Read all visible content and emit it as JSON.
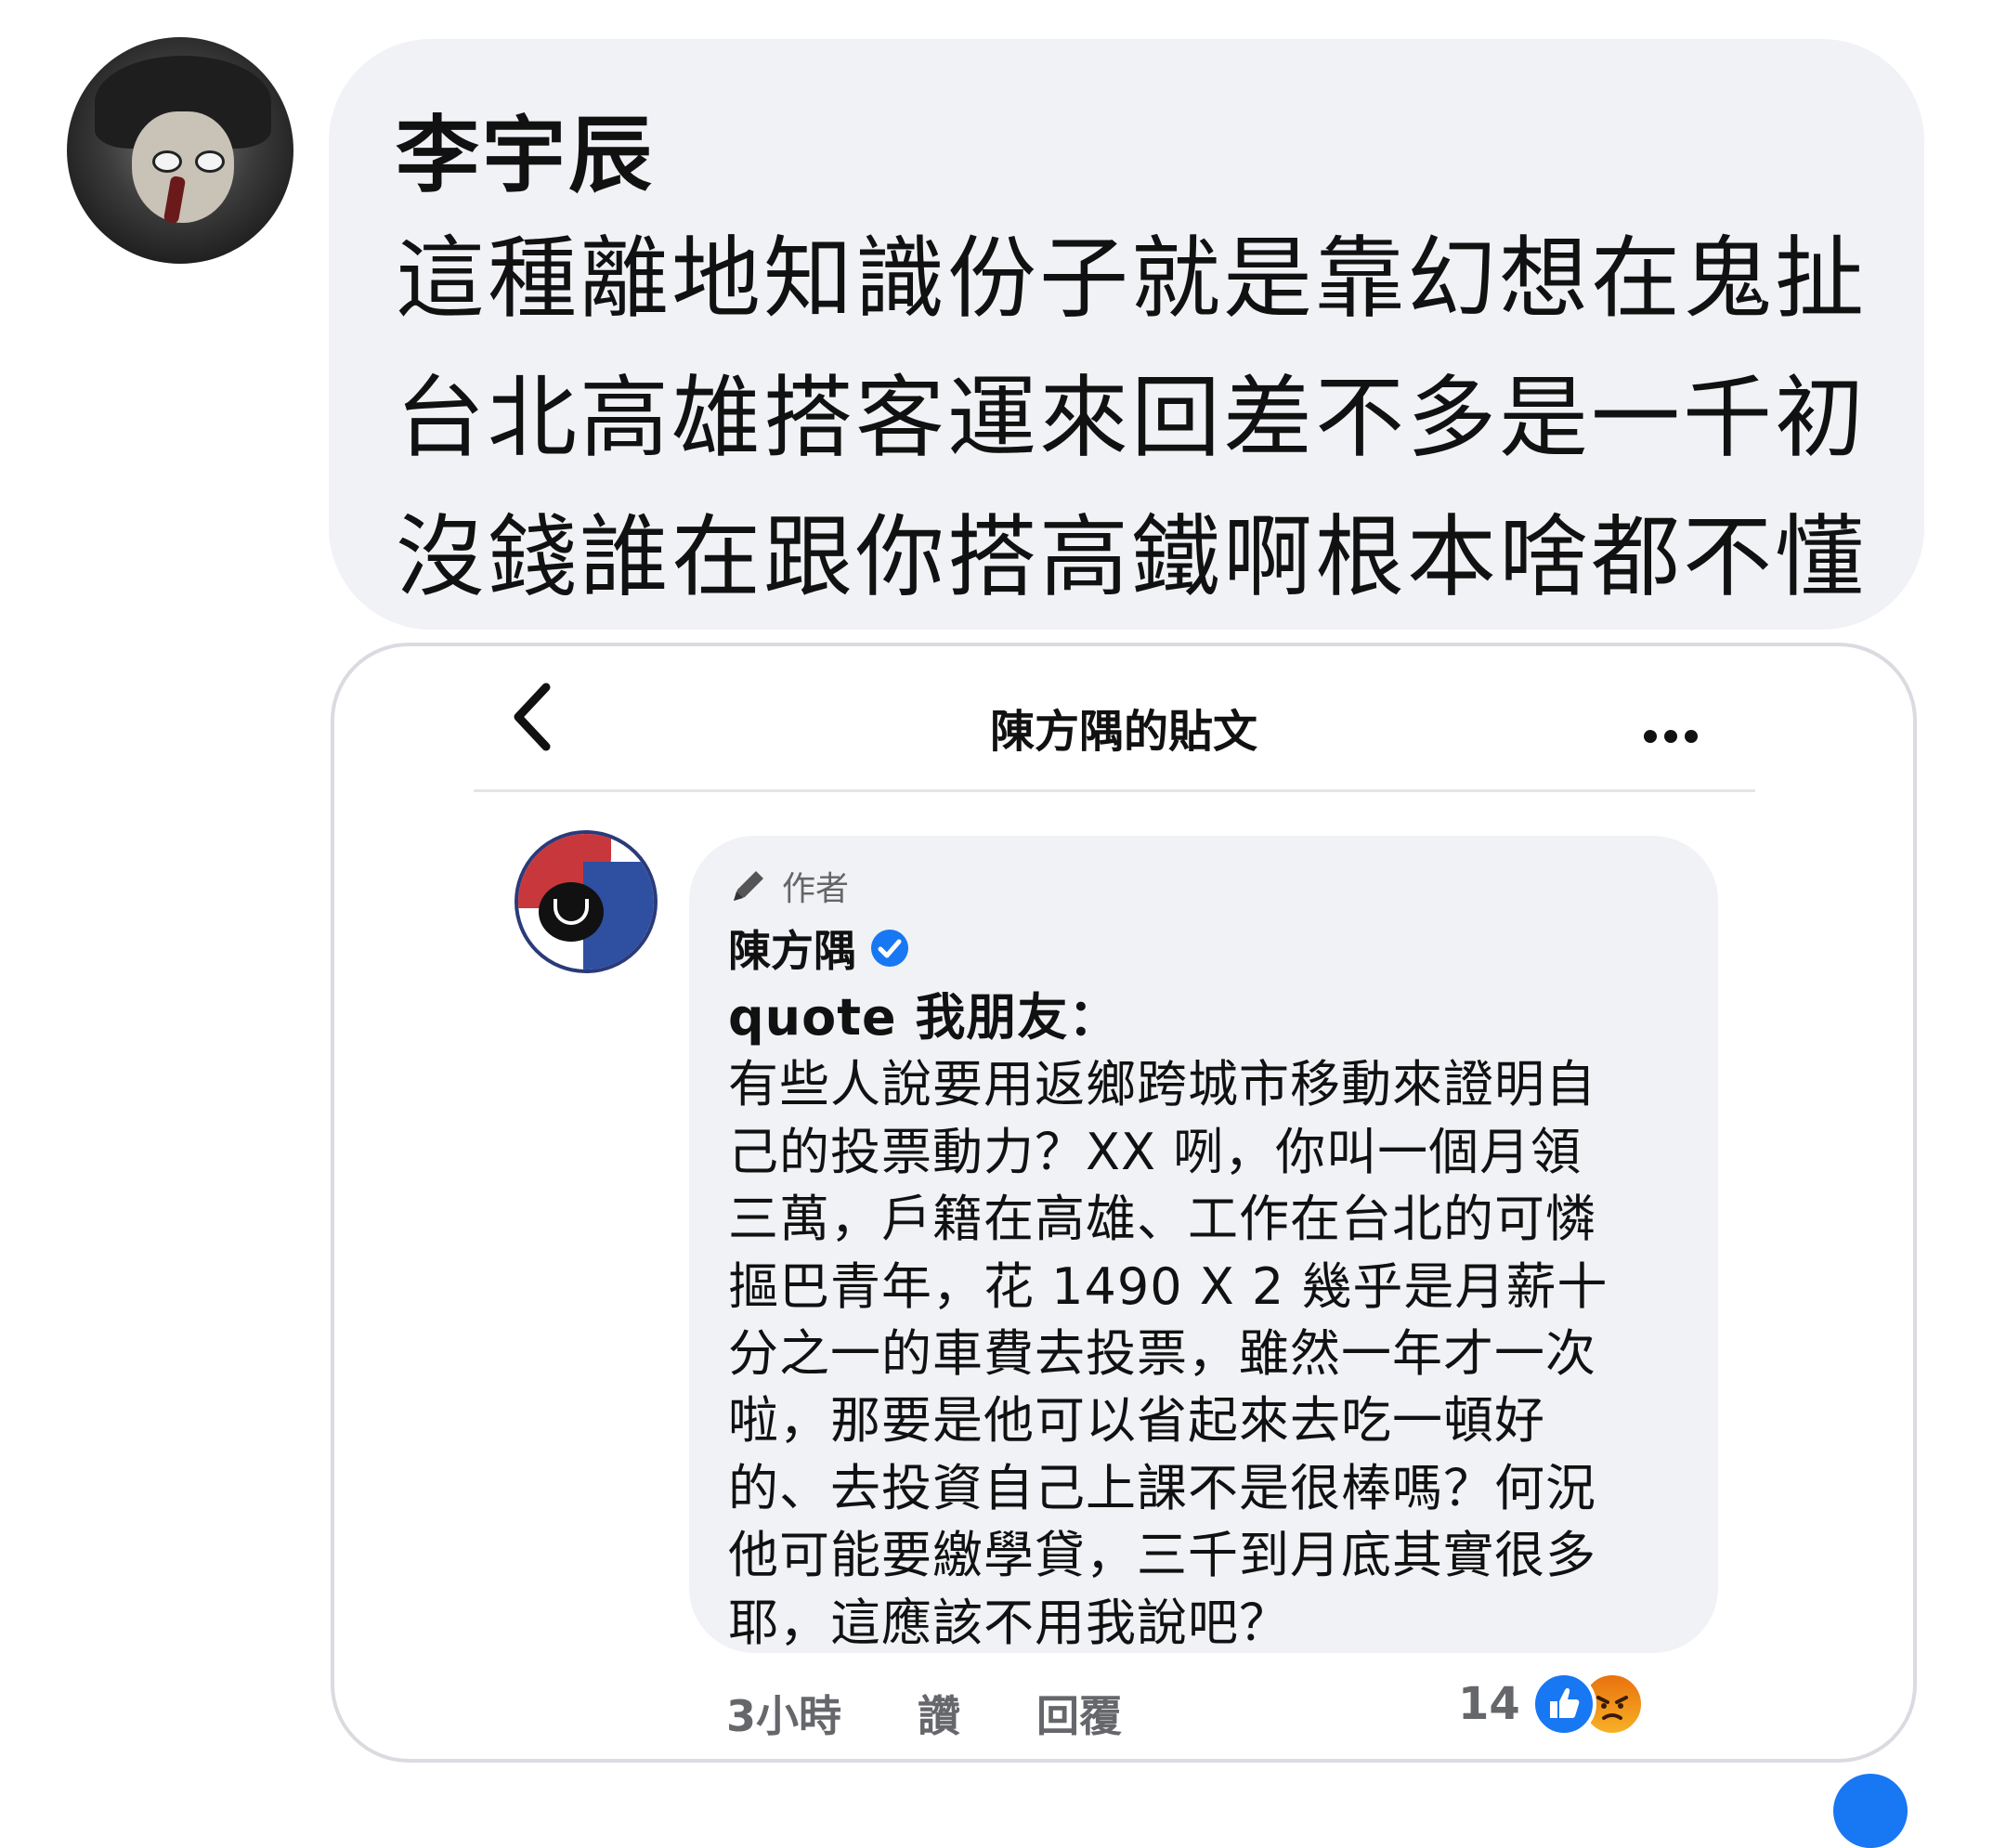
{
  "comment": {
    "author": "李宇辰",
    "lines": [
      "這種離地知識份子就是靠幻想在鬼扯",
      "台北高雄搭客運來回差不多是一千初",
      "沒錢誰在跟你搭高鐵啊根本啥都不懂"
    ]
  },
  "screenshot": {
    "nav": {
      "back_icon": "chevron-left-icon",
      "title": "陳方隅的貼文",
      "more_icon": "more-dots-icon"
    },
    "reply": {
      "badge_label": "作者",
      "author": "陳方隅",
      "lines": [
        "quote 我朋友：",
        "有些人說要用返鄉跨城市移動來證明自",
        "己的投票動力？XX 咧，你叫一個月領",
        "三萬，戶籍在高雄、工作在台北的可憐",
        "摳巴青年，花 1490 X 2 幾乎是月薪十",
        "分之一的車費去投票，雖然一年才一次",
        "啦，那要是他可以省起來去吃一頓好",
        "的、去投資自己上課不是很棒嗎？何況",
        "他可能要繳學貸，三千到月底其實很多",
        "耶，這應該不用我說吧？"
      ]
    },
    "actions": {
      "time": "3小時",
      "like": "讚",
      "reply": "回覆"
    },
    "reactions": {
      "count": "14",
      "icons": [
        "like-icon",
        "angry-icon"
      ]
    }
  },
  "colors": {
    "bubble": "#f0f2f5",
    "accent": "#1877f2",
    "muted": "#65676b"
  }
}
